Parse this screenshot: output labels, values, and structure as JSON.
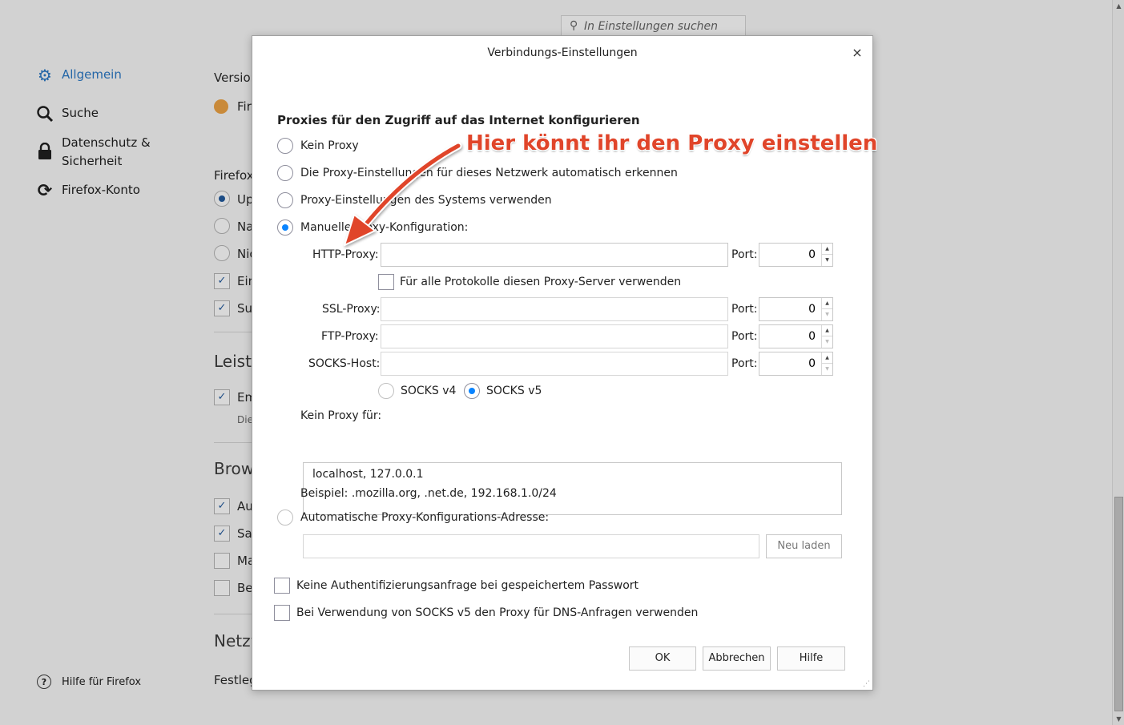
{
  "background": {
    "search_placeholder": "In Einstellungen suchen",
    "nav": [
      {
        "label": "Allgemein",
        "icon": "gear-icon"
      },
      {
        "label": "Suche",
        "icon": "search-icon"
      },
      {
        "label": "Datenschutz & Sicherheit",
        "icon": "lock-icon"
      },
      {
        "label": "Firefox-Konto",
        "icon": "sync-icon"
      }
    ],
    "help_label": "Hilfe für Firefox",
    "fragments": {
      "version": "Version",
      "fire": "Fire",
      "firefox": "Firefox",
      "up": "Up",
      "na": "Na",
      "nic": "Nic",
      "ein": "Ein",
      "suc": "Suc",
      "leistu": "Leistu",
      "em": "Em",
      "die": "Die",
      "brow": "Brow",
      "au": "Au",
      "sar": "Sar",
      "ma": "Ma",
      "bei": "Bei",
      "netzw": "Netzw",
      "festleg": "Festleg"
    }
  },
  "dialog": {
    "title": "Verbindungs-Einstellungen",
    "close_glyph": "×",
    "heading": "Proxies für den Zugriff auf das Internet konfigurieren",
    "options": {
      "none": "Kein Proxy",
      "auto_detect": "Die Proxy-Einstellungen für dieses Netzwerk automatisch erkennen",
      "system": "Proxy-Einstellungen des Systems verwenden",
      "manual": "Manuelle Proxy-Konfiguration:",
      "pac": "Automatische Proxy-Konfigurations-Adresse:"
    },
    "selected_option": "manual",
    "http_label": "HTTP-Proxy:",
    "ssl_label": "SSL-Proxy:",
    "ftp_label": "FTP-Proxy:",
    "socks_label": "SOCKS-Host:",
    "port_label": "Port:",
    "http_value": "",
    "ssl_value": "",
    "ftp_value": "",
    "socks_value": "",
    "http_port": "0",
    "ssl_port": "0",
    "ftp_port": "0",
    "socks_port": "0",
    "all_protocols_label": "Für alle Protokolle diesen Proxy-Server verwenden",
    "socks_v4": "SOCKS v4",
    "socks_v5": "SOCKS v5",
    "socks_selected": "v5",
    "no_proxy_label": "Kein Proxy für:",
    "no_proxy_value": "localhost, 127.0.0.1",
    "example": "Beispiel: .mozilla.org, .net.de, 192.168.1.0/24",
    "pac_value": "",
    "reload_label": "Neu laden",
    "no_auth_label": "Keine Authentifizierungsanfrage bei gespeichertem Passwort",
    "socks_dns_label": "Bei Verwendung von SOCKS v5 den Proxy für DNS-Anfragen verwenden",
    "ok_label": "OK",
    "cancel_label": "Abbrechen",
    "help_label": "Hilfe"
  },
  "annotation": {
    "text": "Hier könnt ihr den Proxy einstellen",
    "color": "#e0452a"
  },
  "colors": {
    "accent": "#0a84ff",
    "nav_active": "#2466a7"
  }
}
